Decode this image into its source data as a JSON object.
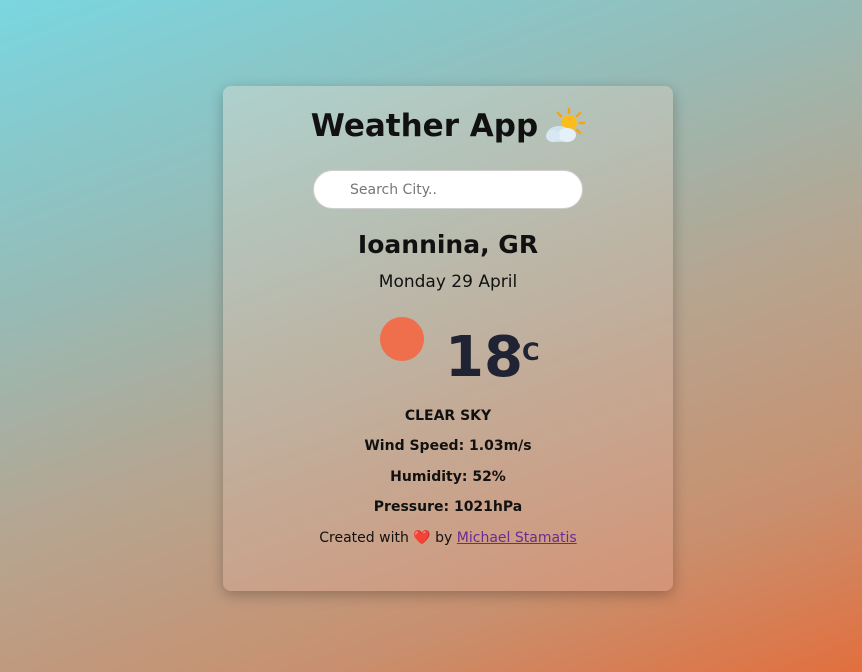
{
  "app": {
    "title": "Weather App"
  },
  "search": {
    "placeholder": "Search City..",
    "value": ""
  },
  "weather": {
    "location": "Ioannina, GR",
    "date": "Monday 29 April",
    "temperature": "18",
    "unit": "°C",
    "condition": "CLEAR SKY",
    "wind_speed": "Wind Speed: 1.03m/s",
    "humidity": "Humidity: 52%",
    "pressure": "Pressure: 1021hPa"
  },
  "footer": {
    "prefix": "Created with",
    "heart": "❤️",
    "by": "by",
    "author": "Michael Stamatis"
  },
  "icons": {
    "title_icon": "sun-behind-cloud-icon",
    "weather_icon": "sun-icon"
  },
  "colors": {
    "sun": "#ef6f4c",
    "temperature_text": "#1f2333",
    "link": "#6a2c91"
  }
}
